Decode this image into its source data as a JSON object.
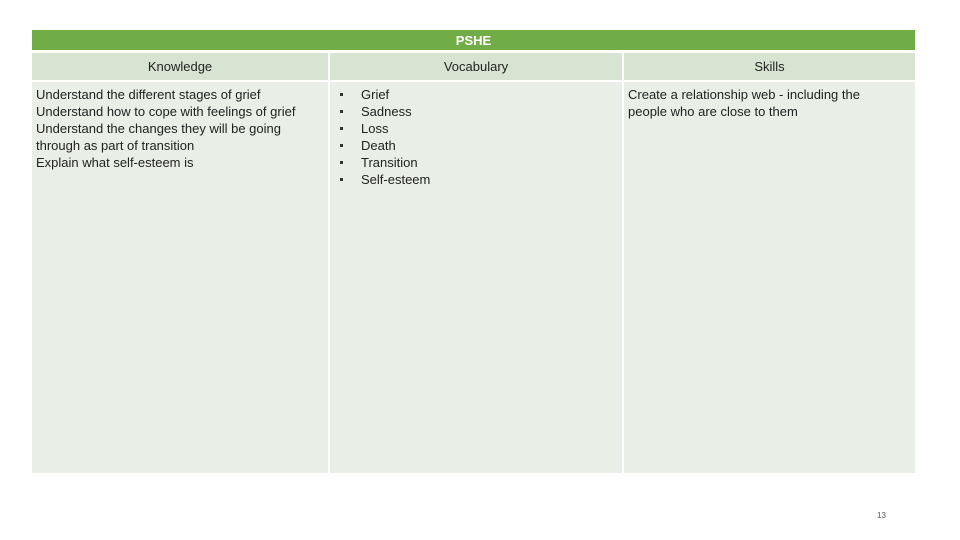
{
  "table": {
    "title": "PSHE",
    "headers": [
      "Knowledge",
      "Vocabulary",
      "Skills"
    ],
    "knowledge_lines": [
      "Understand the different stages of grief",
      "Understand how to cope with feelings of grief",
      "Understand the changes they will be going",
      "through as part of transition",
      "Explain what self-esteem is"
    ],
    "vocabulary": [
      "Grief",
      "Sadness",
      "Loss",
      "Death",
      "Transition",
      "Self-esteem"
    ],
    "skills_lines": [
      "Create a relationship web - including the",
      "people who are close to them"
    ]
  },
  "page_number": "13",
  "colors": {
    "title_bar": "#70ad47",
    "header_row": "#d8e4d2",
    "body_cell": "#e9eee6"
  }
}
